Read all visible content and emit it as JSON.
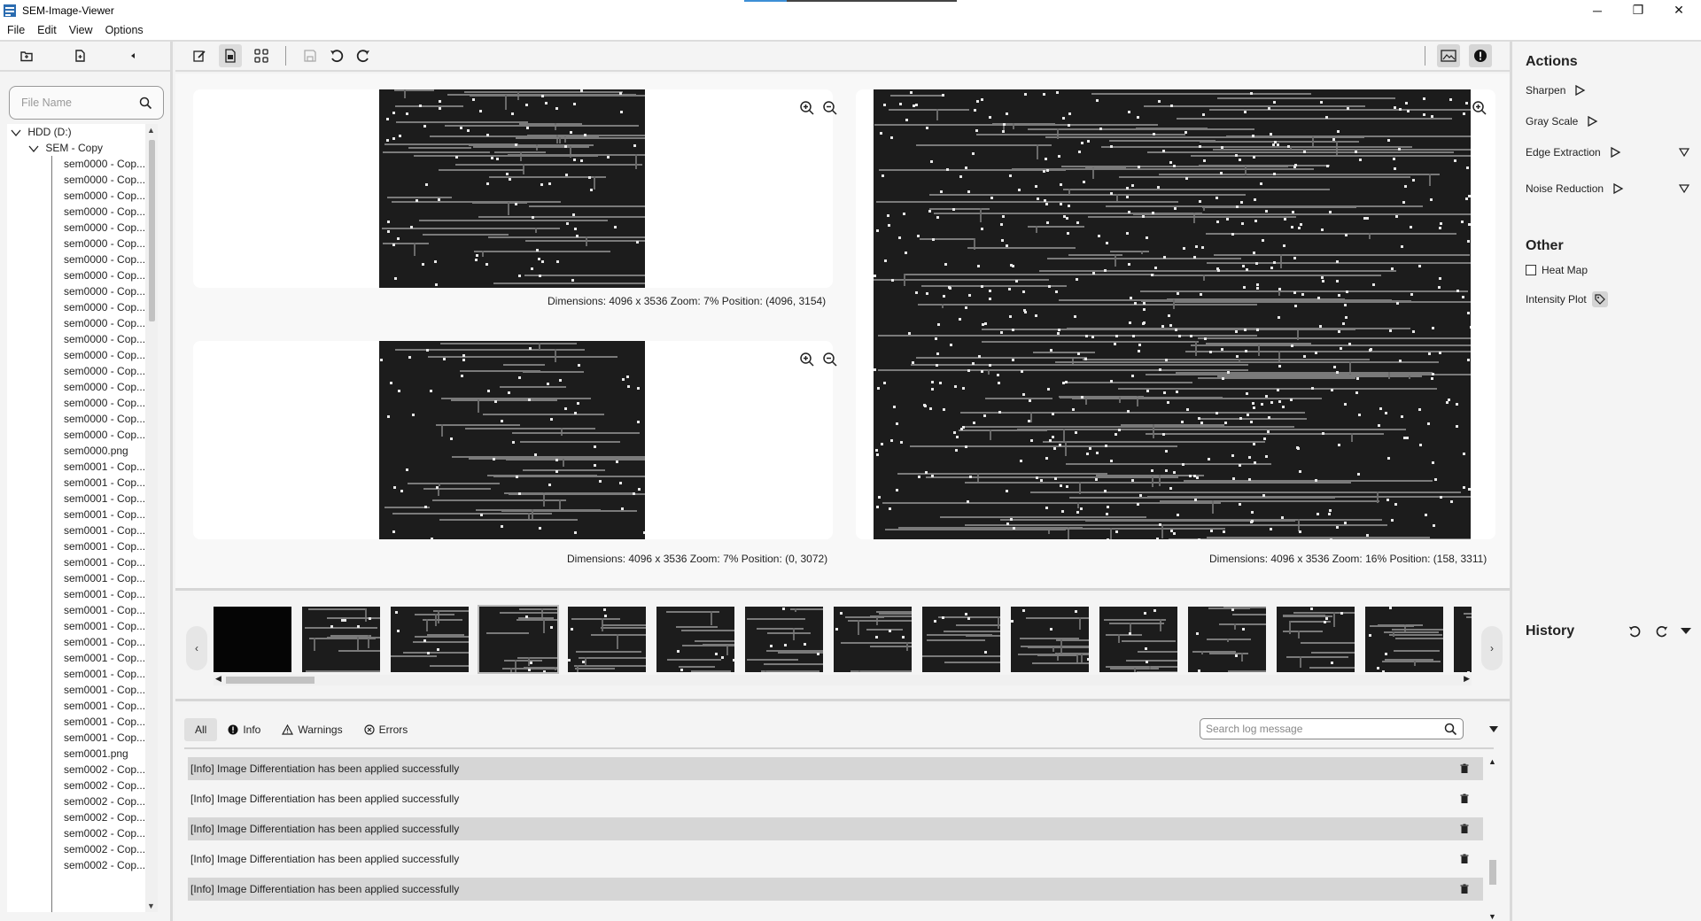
{
  "window": {
    "title": "SEM-Image-Viewer",
    "minimize": "─",
    "restore": "❐",
    "close": "✕"
  },
  "menu": [
    "File",
    "Edit",
    "View",
    "Options"
  ],
  "file_search": {
    "placeholder": "File Name"
  },
  "tree": {
    "drive": "HDD (D:)",
    "folder": "SEM - Copy",
    "files": [
      "sem0000 - Cop...",
      "sem0000 - Cop...",
      "sem0000 - Cop...",
      "sem0000 - Cop...",
      "sem0000 - Cop...",
      "sem0000 - Cop...",
      "sem0000 - Cop...",
      "sem0000 - Cop...",
      "sem0000 - Cop...",
      "sem0000 - Cop...",
      "sem0000 - Cop...",
      "sem0000 - Cop...",
      "sem0000 - Cop...",
      "sem0000 - Cop...",
      "sem0000 - Cop...",
      "sem0000 - Cop...",
      "sem0000 - Cop...",
      "sem0000 - Cop...",
      "sem0000.png",
      "sem0001 - Cop...",
      "sem0001 - Cop...",
      "sem0001 - Cop...",
      "sem0001 - Cop...",
      "sem0001 - Cop...",
      "sem0001 - Cop...",
      "sem0001 - Cop...",
      "sem0001 - Cop...",
      "sem0001 - Cop...",
      "sem0001 - Cop...",
      "sem0001 - Cop...",
      "sem0001 - Cop...",
      "sem0001 - Cop...",
      "sem0001 - Cop...",
      "sem0001 - Cop...",
      "sem0001 - Cop...",
      "sem0001 - Cop...",
      "sem0001 - Cop...",
      "sem0001.png",
      "sem0002 - Cop...",
      "sem0002 - Cop...",
      "sem0002 - Cop...",
      "sem0002 - Cop...",
      "sem0002 - Cop...",
      "sem0002 - Cop...",
      "sem0002 - Cop..."
    ]
  },
  "viewers": [
    {
      "status": "Dimensions: 4096 x 3536  Zoom: 7%  Position: (4096, 3154)"
    },
    {
      "status": "Dimensions: 4096 x 3536  Zoom: 7%  Position: (0, 3072)"
    },
    {
      "status": "Dimensions: 4096 x 3536  Zoom: 16%  Position: (158, 3311)"
    }
  ],
  "log": {
    "tabs": [
      "All",
      "Info",
      "Warnings",
      "Errors"
    ],
    "search_placeholder": "Search log message",
    "messages": [
      "[Info] Image Differentiation has been applied successfully",
      "[Info] Image Differentiation has been applied successfully",
      "[Info] Image Differentiation has been applied successfully",
      "[Info] Image Differentiation has been applied successfully",
      "[Info] Image Differentiation has been applied successfully"
    ]
  },
  "panel": {
    "actions_title": "Actions",
    "actions": [
      "Sharpen",
      "Gray Scale",
      "Edge Extraction",
      "Noise Reduction"
    ],
    "other_title": "Other",
    "heat_map": "Heat Map",
    "intensity_plot": "Intensity Plot",
    "history_title": "History"
  },
  "colors": {
    "accent": "#3d8fd6",
    "row_shade": "#d6d6d6"
  }
}
